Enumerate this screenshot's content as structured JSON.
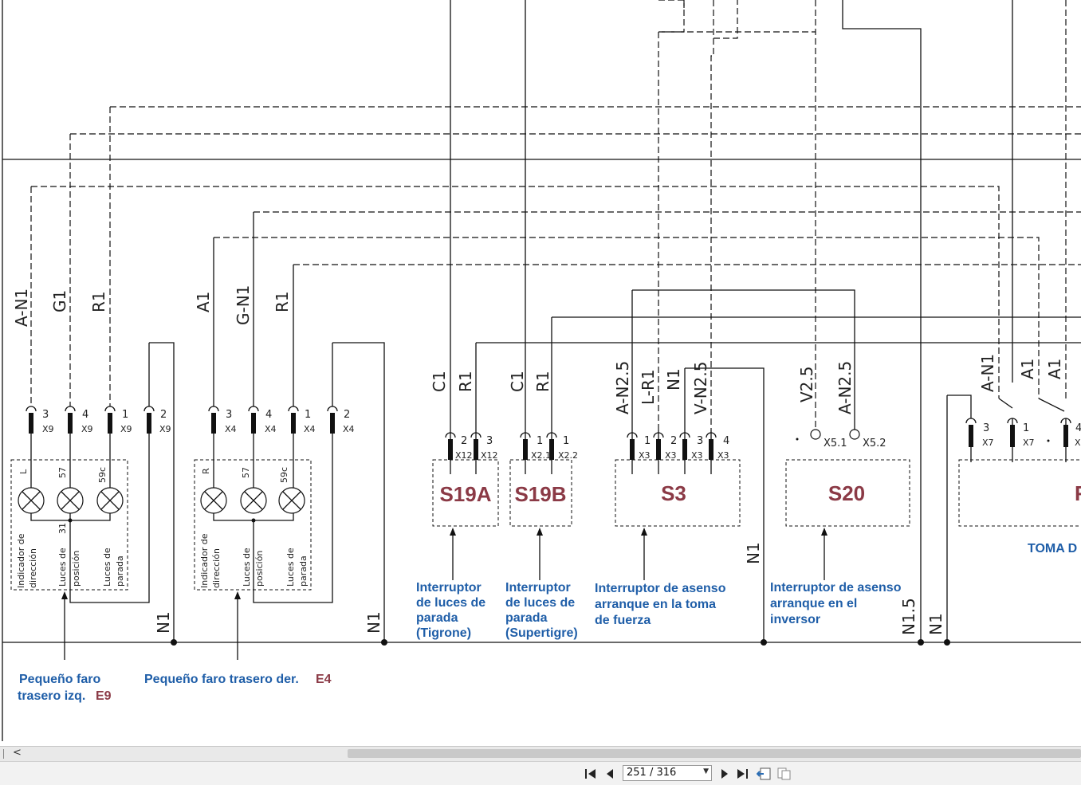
{
  "wire_labels": {
    "e9_a": "A-N1",
    "e9_b": "G1",
    "e9_c": "R1",
    "e4_a": "A1",
    "e4_b": "G-N1",
    "e4_c": "R1",
    "s19a_a": "C1",
    "s19a_b": "R1",
    "s19b_a": "C1",
    "s19b_b": "R1",
    "s3_a": "A-N2.5",
    "s3_b": "L-R1",
    "s3_c": "N1",
    "s3_d": "V-N2.5",
    "s20_a": "V2.5",
    "s20_b": "A-N2.5",
    "toma_a": "A-N1",
    "toma_b": "A1",
    "toma_c": "A1",
    "n1_1": "N1",
    "n1_2": "N1",
    "n1_3": "N1",
    "n15": "N1.5",
    "n1_4": "N1"
  },
  "pins": {
    "e9": [
      "3",
      "4",
      "1",
      "2"
    ],
    "e4": [
      "3",
      "4",
      "1",
      "2"
    ],
    "s19a": [
      "2",
      "3"
    ],
    "s19b": [
      "1",
      "1"
    ],
    "s3": [
      "1",
      "1",
      "2",
      "3",
      "4"
    ],
    "toma": [
      "3",
      "1",
      "4"
    ]
  },
  "connectors": {
    "e9": [
      "X9",
      "X9",
      "X9",
      "X9"
    ],
    "e4": [
      "X4",
      "X4",
      "X4",
      "X4"
    ],
    "s19a": [
      "X12",
      "X12"
    ],
    "s19b": [
      "X2.1",
      "X2.2"
    ],
    "s3": [
      "X3",
      "X3",
      "X3",
      "X3"
    ],
    "s20": [
      "X5.1",
      "X5.2"
    ],
    "toma": [
      "X7",
      "X7",
      "X"
    ]
  },
  "lamp_terminals": {
    "e9": [
      "L",
      "57",
      "59c",
      "31"
    ],
    "e4": [
      "R",
      "57",
      "59c"
    ]
  },
  "lamp_labels": {
    "e9": [
      "Indicador de",
      "dirección",
      "Luces de",
      "posición",
      "Luces de",
      "parada"
    ],
    "e4": [
      "Indicador de",
      "dirección",
      "Luces de",
      "posición",
      "Luces de",
      "parada"
    ]
  },
  "components": {
    "s19a": "S19A",
    "s19b": "S19B",
    "s3": "S3",
    "s20": "S20",
    "toma": "F"
  },
  "captions": {
    "s19a": [
      "Interruptor",
      "de luces de",
      "parada",
      "(Tigrone)"
    ],
    "s19b": [
      "Interruptor",
      "de luces de",
      "parada",
      "(Supertigre)"
    ],
    "s3": [
      "Interruptor de asenso",
      "arranque en la toma",
      "de fuerza"
    ],
    "s20": [
      "Interruptor de asenso",
      "arranque en el",
      "inversor"
    ],
    "toma": "TOMA D",
    "e9_line1": "Pequeño faro",
    "e9_line2": "trasero izq.",
    "e9_ref": "E9",
    "e4_text": "Pequeño faro trasero der.",
    "e4_ref": "E4"
  },
  "viewer": {
    "page_indicator": "251 / 316",
    "scroll_left_arrow": "<"
  },
  "colors": {
    "component_label": "#8b3a46",
    "caption": "#1f5ea8",
    "wire": "#111111"
  }
}
